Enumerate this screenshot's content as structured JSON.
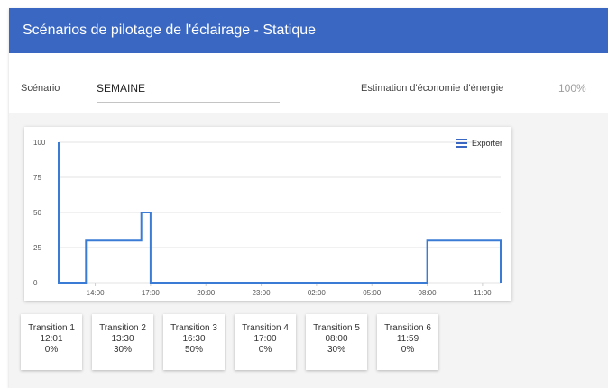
{
  "header": {
    "title": "Scénarios de pilotage de l'éclairage - Statique"
  },
  "form": {
    "scenario_label": "Scénario",
    "scenario_value": "SEMAINE",
    "energy_label": "Estimation d'économie d'énergie",
    "energy_value": "100%"
  },
  "chart": {
    "export_label": "Exporter"
  },
  "chart_data": {
    "type": "line",
    "step": true,
    "x_unit": "time of day (HH:MM)",
    "x_ticks": [
      "14:00",
      "17:00",
      "20:00",
      "23:00",
      "02:00",
      "05:00",
      "08:00",
      "11:00"
    ],
    "y_ticks": [
      0,
      25,
      50,
      75,
      100
    ],
    "ylim": [
      0,
      100
    ],
    "grid": true,
    "series": [
      {
        "color": "#3a7bd5",
        "points": [
          {
            "x": "12:01",
            "y": 100
          },
          {
            "x": "12:01",
            "y": 0
          },
          {
            "x": "13:30",
            "y": 0
          },
          {
            "x": "13:30",
            "y": 30
          },
          {
            "x": "16:30",
            "y": 30
          },
          {
            "x": "16:30",
            "y": 50
          },
          {
            "x": "17:00",
            "y": 50
          },
          {
            "x": "17:00",
            "y": 0
          },
          {
            "x": "08:00",
            "y": 0
          },
          {
            "x": "08:00",
            "y": 30
          },
          {
            "x": "11:59",
            "y": 30
          },
          {
            "x": "11:59",
            "y": 0
          }
        ]
      }
    ]
  },
  "transitions": [
    {
      "title": "Transition 1",
      "time": "12:01",
      "value": "0%"
    },
    {
      "title": "Transition 2",
      "time": "13:30",
      "value": "30%"
    },
    {
      "title": "Transition 3",
      "time": "16:30",
      "value": "50%"
    },
    {
      "title": "Transition 4",
      "time": "17:00",
      "value": "0%"
    },
    {
      "title": "Transition 5",
      "time": "08:00",
      "value": "30%"
    },
    {
      "title": "Transition 6",
      "time": "11:59",
      "value": "0%"
    }
  ]
}
